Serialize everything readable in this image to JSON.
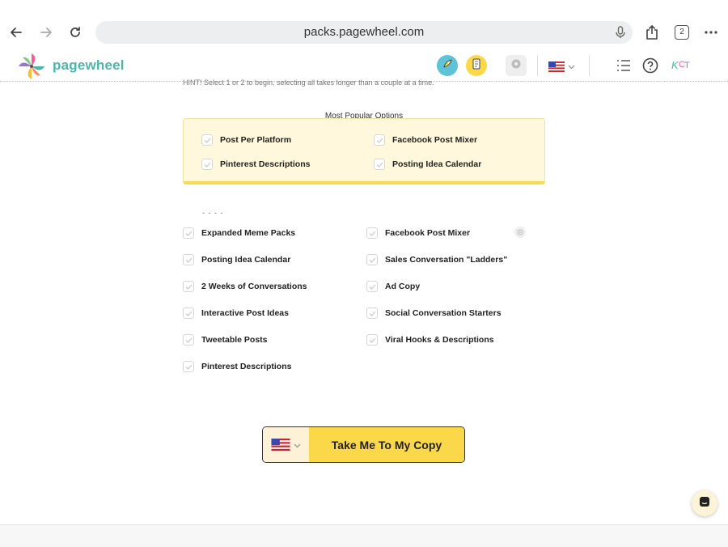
{
  "browser": {
    "url": "packs.pagewheel.com",
    "tab_count": "2"
  },
  "header": {
    "logo_text": "pagewheel"
  },
  "hint": "HINT! Select 1 or 2 to begin, selecting all takes longer than a couple at a time.",
  "popular": {
    "title": "Most Popular Options",
    "options": [
      "Post Per Platform",
      "Facebook Post Mixer",
      "Pinterest Descriptions",
      "Posting Idea Calendar"
    ]
  },
  "section_dashes": "- - - -",
  "all_options": {
    "left": [
      "Expanded Meme Packs",
      "Posting Idea Calendar",
      "2 Weeks of Conversations",
      "Interactive Post Ideas",
      "Tweetable Posts",
      "Pinterest Descriptions"
    ],
    "right": [
      "Facebook Post Mixer",
      "Sales Conversation \"Ladders\"",
      "Ad Copy",
      "Social Conversation Starters",
      "Viral Hooks & Descriptions"
    ]
  },
  "cta": {
    "label": "Take Me To My Copy"
  },
  "colors": {
    "accent_yellow": "#fbd84a",
    "logo_teal": "#4db6ac",
    "popular_bg": "#fff8dc"
  }
}
